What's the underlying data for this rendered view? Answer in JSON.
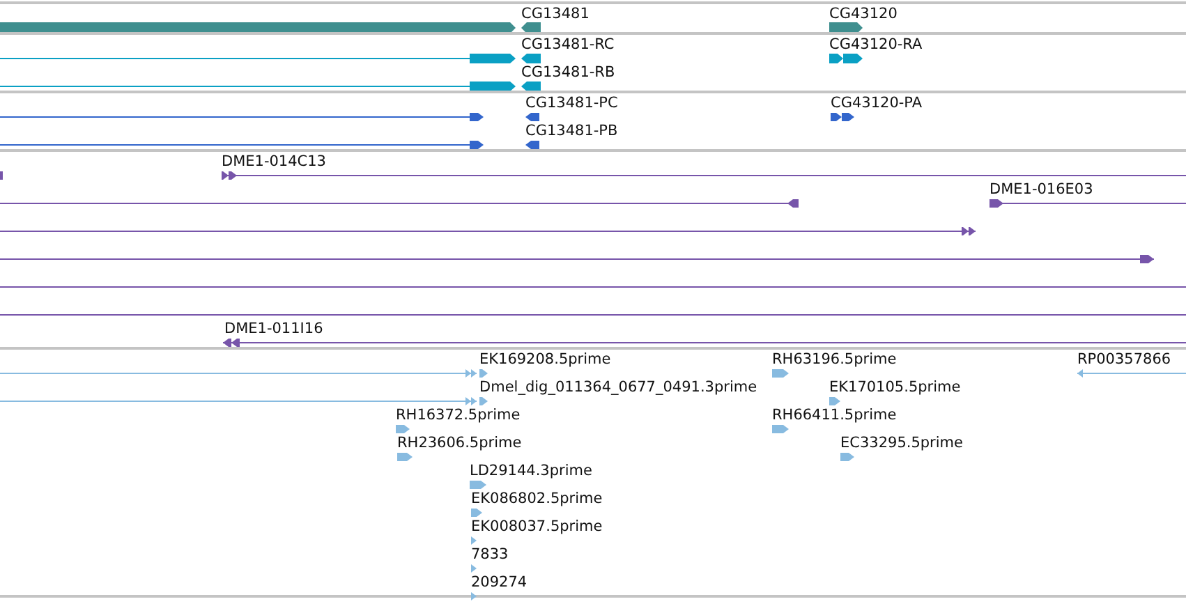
{
  "tracks": [
    {
      "kind": "gene",
      "rows": [
        {
          "features": [
            {
              "reverse": false
            },
            {
              "label": "CG13481",
              "reverse": true
            },
            {
              "label": "CG43120",
              "reverse": false
            }
          ]
        }
      ]
    },
    {
      "kind": "transcript",
      "rows": [
        {
          "features": [
            {
              "reverse": false
            },
            {
              "label": "CG13481-RC",
              "reverse": true
            },
            {
              "label": "CG43120-RA",
              "reverse": false
            }
          ]
        },
        {
          "features": [
            {
              "reverse": false
            },
            {
              "label": "CG13481-RB",
              "reverse": true
            }
          ]
        }
      ]
    },
    {
      "kind": "protein",
      "rows": [
        {
          "features": [
            {
              "reverse": false
            },
            {
              "label": "CG13481-PC",
              "reverse": true
            },
            {
              "label": "CG43120-PA",
              "reverse": false
            }
          ]
        },
        {
          "features": [
            {
              "reverse": false
            },
            {
              "label": "CG13481-PB",
              "reverse": true
            }
          ]
        }
      ]
    },
    {
      "kind": "clone",
      "rows": [
        {
          "features": [
            {
              "clipped": true
            },
            {
              "label": "DME1-014C13",
              "reverse": false
            }
          ]
        },
        {
          "features": [
            {
              "reverse": true
            },
            {
              "label": "DME1-016E03",
              "reverse": false
            }
          ]
        },
        {
          "features": [
            {
              "reverse": false
            }
          ]
        },
        {
          "features": [
            {
              "reverse": false
            }
          ]
        },
        {
          "features": [
            {
              "clipped": true
            }
          ]
        },
        {
          "features": [
            {
              "clipped": true
            }
          ]
        },
        {
          "features": [
            {
              "label": "DME1-011I16",
              "reverse": true
            }
          ]
        }
      ]
    },
    {
      "kind": "est",
      "rows": [
        {
          "features": [
            {
              "reverse": false
            },
            {
              "label": "EK169208.5prime",
              "reverse": false
            },
            {
              "label": "RH63196.5prime",
              "reverse": false
            },
            {
              "label": "RP00357866",
              "reverse": true
            }
          ]
        },
        {
          "features": [
            {
              "reverse": false
            },
            {
              "label": "Dmel_dig_011364_0677_0491.3prime",
              "reverse": false
            },
            {
              "label": "EK170105.5prime",
              "reverse": false
            }
          ]
        },
        {
          "features": [
            {
              "label": "RH16372.5prime",
              "reverse": false
            },
            {
              "label": "RH66411.5prime",
              "reverse": false
            }
          ]
        },
        {
          "features": [
            {
              "label": "RH23606.5prime",
              "reverse": false
            },
            {
              "label": "EC33295.5prime",
              "reverse": false
            }
          ]
        },
        {
          "features": [
            {
              "label": "LD29144.3prime",
              "reverse": false
            }
          ]
        },
        {
          "features": [
            {
              "label": "EK086802.5prime",
              "reverse": false
            }
          ]
        },
        {
          "features": [
            {
              "label": "EK008037.5prime",
              "reverse": false
            }
          ]
        },
        {
          "features": [
            {
              "label": "7833",
              "reverse": false
            }
          ]
        },
        {
          "features": [
            {
              "label": "209274",
              "reverse": false
            }
          ]
        }
      ]
    }
  ]
}
